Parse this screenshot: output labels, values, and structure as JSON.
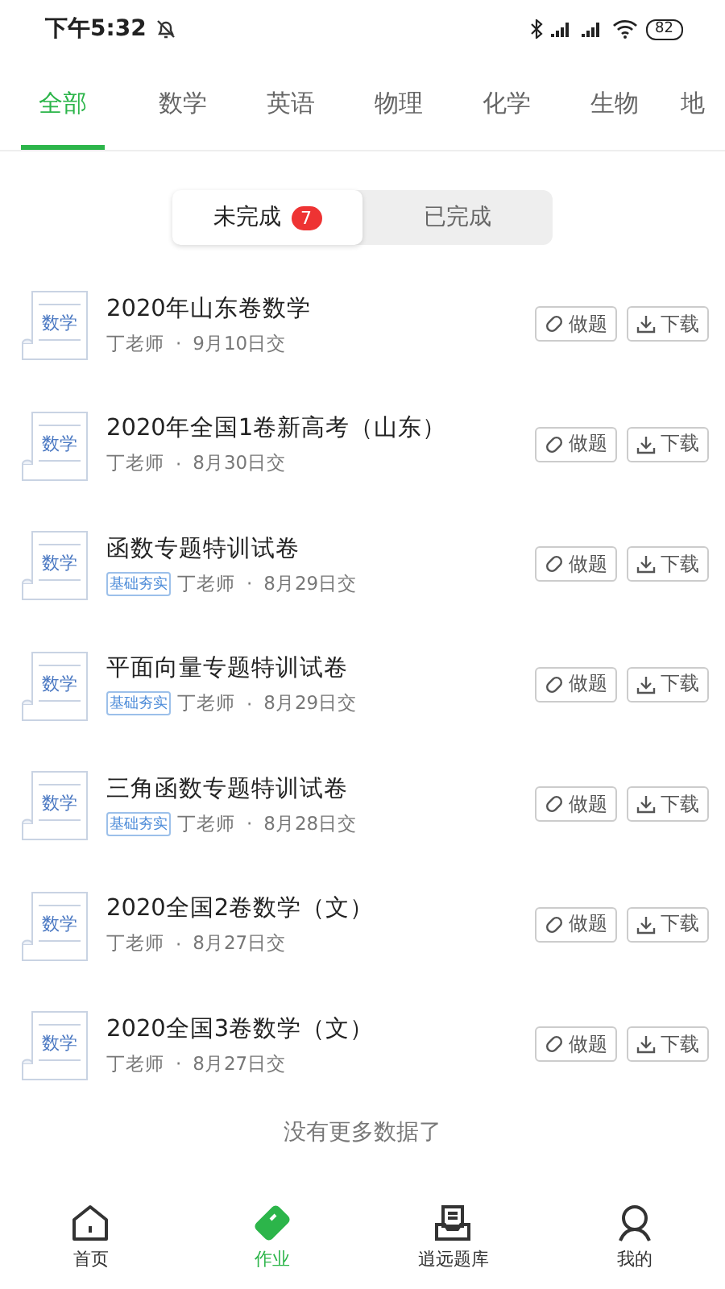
{
  "status_bar": {
    "time": "下午5:32",
    "battery": "82"
  },
  "subject_tabs": [
    {
      "label": "全部",
      "selected": true
    },
    {
      "label": "数学",
      "selected": false
    },
    {
      "label": "英语",
      "selected": false
    },
    {
      "label": "物理",
      "selected": false
    },
    {
      "label": "化学",
      "selected": false
    },
    {
      "label": "生物",
      "selected": false
    },
    {
      "label": "地",
      "selected": false
    }
  ],
  "status_toggle": [
    {
      "label": "未完成",
      "badge": "7",
      "selected": true
    },
    {
      "label": "已完成",
      "selected": false
    }
  ],
  "assignments": [
    {
      "subject": "数学",
      "title": "2020年山东卷数学",
      "teacher": "丁老师",
      "separator": "·",
      "due": "9月10日交",
      "actions": [
        "做题",
        "下载"
      ]
    },
    {
      "subject": "数学",
      "title": "2020年全国1卷新高考（山东）",
      "teacher": "丁老师",
      "separator": "·",
      "due": "8月30日交",
      "actions": [
        "做题",
        "下载"
      ]
    },
    {
      "subject": "数学",
      "title": "函数专题特训试卷",
      "tag": "基础夯实",
      "teacher": "丁老师",
      "separator": "·",
      "due": "8月29日交",
      "actions": [
        "做题",
        "下载"
      ]
    },
    {
      "subject": "数学",
      "title": "平面向量专题特训试卷",
      "tag": "基础夯实",
      "teacher": "丁老师",
      "separator": "·",
      "due": "8月29日交",
      "actions": [
        "做题",
        "下载"
      ]
    },
    {
      "subject": "数学",
      "title": "三角函数专题特训试卷",
      "tag": "基础夯实",
      "teacher": "丁老师",
      "separator": "·",
      "due": "8月28日交",
      "actions": [
        "做题",
        "下载"
      ]
    },
    {
      "subject": "数学",
      "title": "2020全国2卷数学（文）",
      "teacher": "丁老师",
      "separator": "·",
      "due": "8月27日交",
      "actions": [
        "做题",
        "下载"
      ]
    },
    {
      "subject": "数学",
      "title": "2020全国3卷数学（文）",
      "teacher": "丁老师",
      "separator": "·",
      "due": "8月27日交",
      "actions": [
        "做题",
        "下载"
      ]
    }
  ],
  "end_note": "没有更多数据了",
  "bottom_nav": [
    {
      "kind": "home",
      "label": "首页",
      "selected": false
    },
    {
      "kind": "homework",
      "label": "作业",
      "selected": true
    },
    {
      "kind": "bank",
      "label": "逍远题库",
      "selected": false
    },
    {
      "kind": "profile",
      "label": "我的",
      "selected": false
    }
  ]
}
